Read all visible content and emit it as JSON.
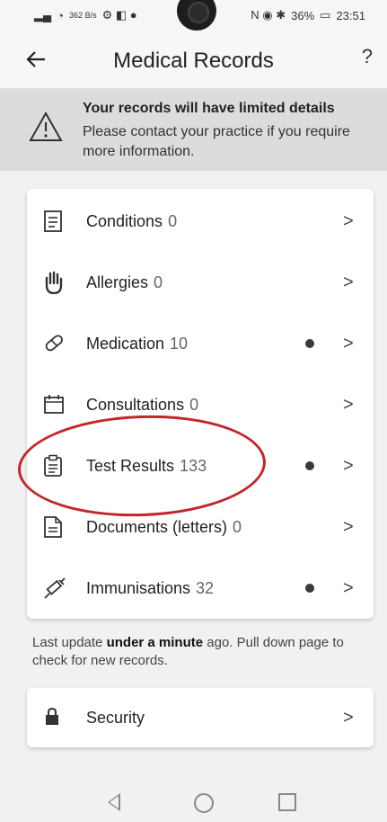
{
  "statusbar": {
    "left_text": "362 B/s",
    "battery": "36%",
    "time": "23:51"
  },
  "header": {
    "title": "Medical Records",
    "back_icon": "back-arrow-icon",
    "help_label": "?"
  },
  "warning": {
    "title": "Your records will have limited details",
    "body": "Please contact your practice if you require more information."
  },
  "records": {
    "items": [
      {
        "name": "Conditions",
        "count": "0",
        "icon": "document-list-icon",
        "dot": false
      },
      {
        "name": "Allergies",
        "count": "0",
        "icon": "hand-icon",
        "dot": false
      },
      {
        "name": "Medication",
        "count": "10",
        "icon": "pill-icon",
        "dot": true
      },
      {
        "name": "Consultations",
        "count": "0",
        "icon": "calendar-icon",
        "dot": false
      },
      {
        "name": "Test Results",
        "count": "133",
        "icon": "clipboard-icon",
        "dot": true
      },
      {
        "name": "Documents (letters)",
        "count": "0",
        "icon": "document-icon",
        "dot": false
      },
      {
        "name": "Immunisations",
        "count": "32",
        "icon": "syringe-icon",
        "dot": true
      }
    ]
  },
  "note": {
    "prefix": "Last update ",
    "bold": "under a minute",
    "suffix": " ago. Pull down page to check for new records."
  },
  "security": {
    "label": "Security",
    "icon": "lock-icon"
  },
  "chevron": ">",
  "colors": {
    "highlight_circle": "#c2262c",
    "warning_bg": "#dcdcdc",
    "dot": "#3a3a3a"
  }
}
